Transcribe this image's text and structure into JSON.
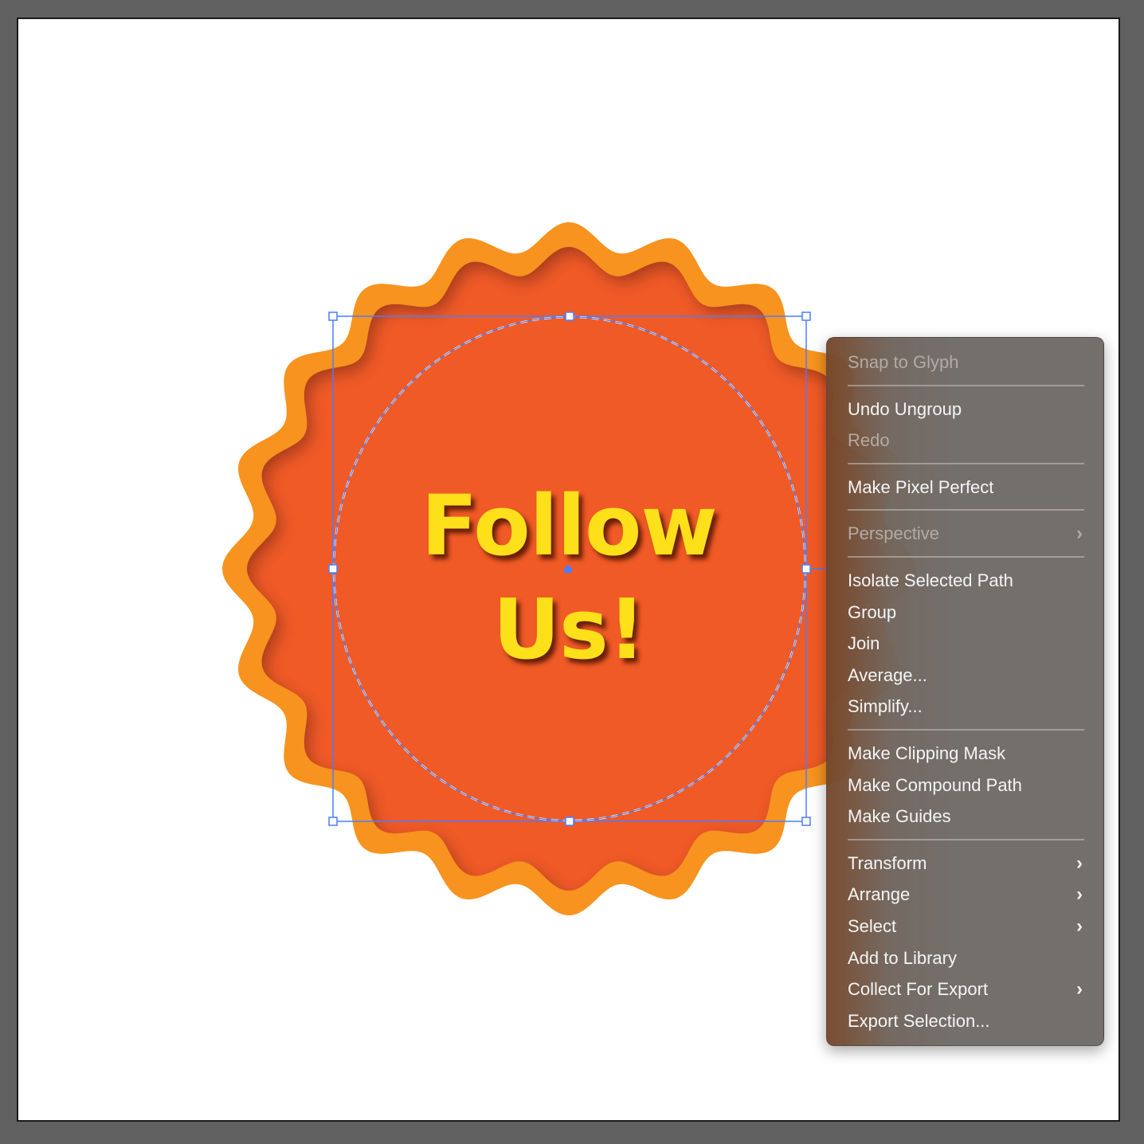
{
  "canvas": {
    "background_color": "#606060",
    "artboard_color": "#ffffff"
  },
  "badge": {
    "outer_color": "#f7931e",
    "inner_color": "#f05a28",
    "text_color": "#fde01a",
    "selection_color": "#4a7dff",
    "line1": "Follow",
    "line2": "Us!"
  },
  "context_menu": {
    "groups": [
      [
        {
          "label": "Snap to Glyph",
          "enabled": false,
          "submenu": false
        }
      ],
      [
        {
          "label": "Undo Ungroup",
          "enabled": true,
          "submenu": false
        },
        {
          "label": "Redo",
          "enabled": false,
          "submenu": false
        }
      ],
      [
        {
          "label": "Make Pixel Perfect",
          "enabled": true,
          "submenu": false
        }
      ],
      [
        {
          "label": "Perspective",
          "enabled": false,
          "submenu": true
        }
      ],
      [
        {
          "label": "Isolate Selected Path",
          "enabled": true,
          "submenu": false
        },
        {
          "label": "Group",
          "enabled": true,
          "submenu": false
        },
        {
          "label": "Join",
          "enabled": true,
          "submenu": false
        },
        {
          "label": "Average...",
          "enabled": true,
          "submenu": false
        },
        {
          "label": "Simplify...",
          "enabled": true,
          "submenu": false
        }
      ],
      [
        {
          "label": "Make Clipping Mask",
          "enabled": true,
          "submenu": false
        },
        {
          "label": "Make Compound Path",
          "enabled": true,
          "submenu": false
        },
        {
          "label": "Make Guides",
          "enabled": true,
          "submenu": false
        }
      ],
      [
        {
          "label": "Transform",
          "enabled": true,
          "submenu": true
        },
        {
          "label": "Arrange",
          "enabled": true,
          "submenu": true
        },
        {
          "label": "Select",
          "enabled": true,
          "submenu": true
        },
        {
          "label": "Add to Library",
          "enabled": true,
          "submenu": false
        },
        {
          "label": "Collect For Export",
          "enabled": true,
          "submenu": true
        },
        {
          "label": "Export Selection...",
          "enabled": true,
          "submenu": false
        }
      ]
    ],
    "chevron_glyph": "›"
  }
}
